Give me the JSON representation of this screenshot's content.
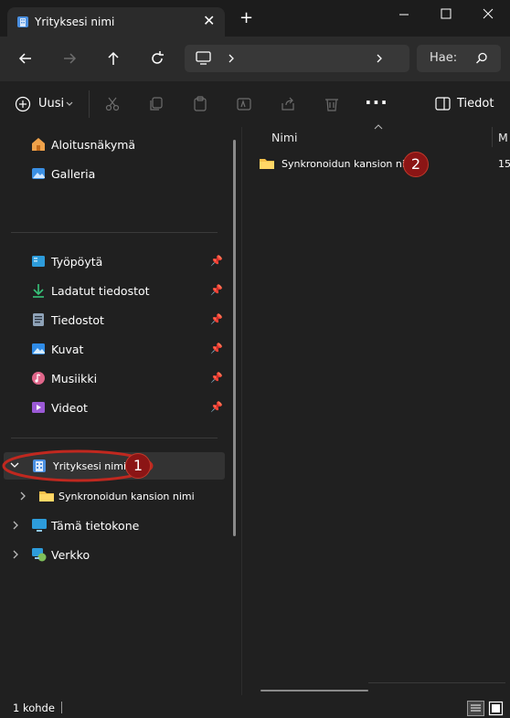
{
  "window": {
    "tab_title": "Yrityksesi nimi",
    "new_tab": "+",
    "close_tab": "✕"
  },
  "address": {
    "search_placeholder": "Hae:"
  },
  "toolbar": {
    "new_label": "Uusi",
    "details_label": "Tiedot",
    "more": "..."
  },
  "sidebar": {
    "top_items": [
      {
        "label": "Aloitusnäkymä",
        "icon": "home-icon"
      },
      {
        "label": "Galleria",
        "icon": "gallery-icon"
      }
    ],
    "quick_access": [
      {
        "label": "Työpöytä",
        "icon": "desktop-icon"
      },
      {
        "label": "Ladatut tiedostot",
        "icon": "download-icon"
      },
      {
        "label": "Tiedostot",
        "icon": "documents-icon"
      },
      {
        "label": "Kuvat",
        "icon": "pictures-icon"
      },
      {
        "label": "Musiikki",
        "icon": "music-icon"
      },
      {
        "label": "Videot",
        "icon": "videos-icon"
      }
    ],
    "tree": [
      {
        "label": "Yrityksesi nimi",
        "icon": "company-building-icon",
        "expanded": true,
        "selected": true
      },
      {
        "label": "Synkronoidun kansion nimi",
        "icon": "folder-icon"
      },
      {
        "label": "Tämä tietokone",
        "icon": "computer-icon"
      },
      {
        "label": "Verkko",
        "icon": "network-icon"
      }
    ]
  },
  "content": {
    "column_name": "Nimi",
    "column_modified_partial": "M",
    "rows": [
      {
        "name": "Synkronoidun kansion nimi",
        "modified_partial": "15"
      }
    ]
  },
  "callouts": [
    "1",
    "2"
  ],
  "status": {
    "count": "1 kohde"
  },
  "colors": {
    "callout_fill": "#8b1515",
    "highlight_ellipse": "#c0281f",
    "folder_yellow": "#f5c04a"
  }
}
